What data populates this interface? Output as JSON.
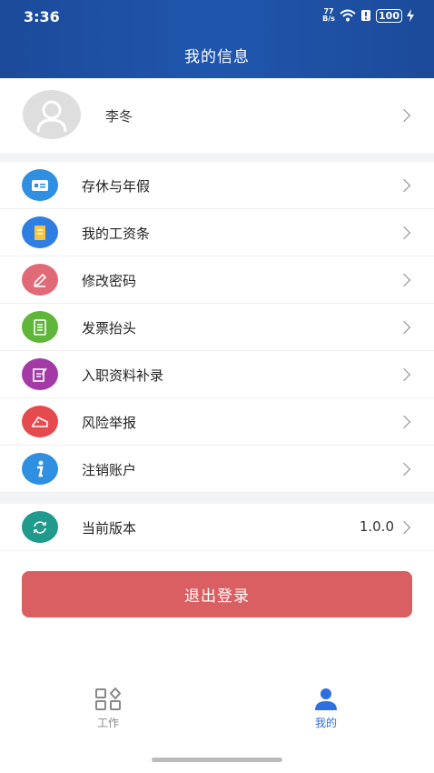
{
  "status_bar": {
    "time": "3:36",
    "speed_top": "77",
    "speed_bottom": "B/s",
    "battery": "100"
  },
  "header": {
    "title": "我的信息"
  },
  "profile": {
    "name": "李冬"
  },
  "menu": [
    {
      "label": "存休与年假",
      "icon": "id-card-icon",
      "color": "#2f8fe0"
    },
    {
      "label": "我的工资条",
      "icon": "payslip-icon",
      "color": "#2f7fe3"
    },
    {
      "label": "修改密码",
      "icon": "pencil-icon",
      "color": "#e06a78"
    },
    {
      "label": "发票抬头",
      "icon": "invoice-icon",
      "color": "#5fb63a"
    },
    {
      "label": "入职资料补录",
      "icon": "edit-document-icon",
      "color": "#a33aa6"
    },
    {
      "label": "风险举报",
      "icon": "alert-tag-icon",
      "color": "#e54a4f"
    },
    {
      "label": "注销账户",
      "icon": "info-icon",
      "color": "#2f8fe0"
    }
  ],
  "version": {
    "label": "当前版本",
    "value": "1.0.0",
    "icon": "refresh-icon",
    "color": "#1f9a8c"
  },
  "logout": {
    "label": "退出登录"
  },
  "tabbar": {
    "work": {
      "label": "工作",
      "color": "#888888"
    },
    "mine": {
      "label": "我的",
      "color": "#2f6fe0"
    }
  }
}
